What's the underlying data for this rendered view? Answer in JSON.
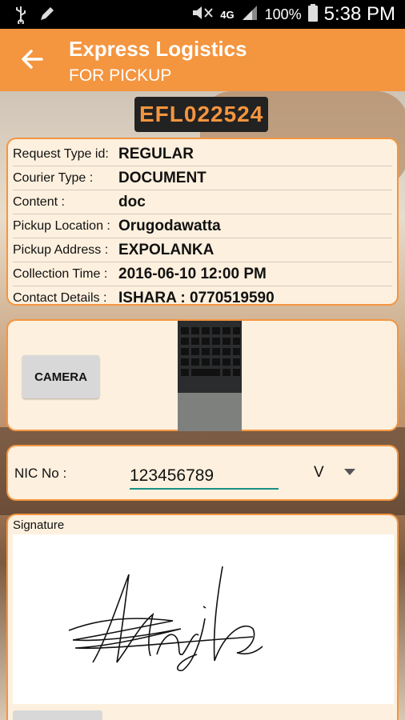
{
  "status_bar": {
    "time": "5:38 PM",
    "battery": "100%",
    "network": "4G",
    "icons": [
      "usb-icon",
      "pencil-icon",
      "mute-icon",
      "signal-icon",
      "battery-icon"
    ]
  },
  "app_bar": {
    "title": "Express Logistics",
    "subtitle": "FOR PICKUP",
    "back_icon": "arrow-back-icon",
    "color": "#f4953f"
  },
  "tracking_number": "EFL022524",
  "details": [
    {
      "label": "Request Type id:",
      "value": "REGULAR"
    },
    {
      "label": "Courier Type :",
      "value": "DOCUMENT"
    },
    {
      "label": "Content :",
      "value": "doc"
    },
    {
      "label": "Pickup Location :",
      "value": "Orugodawatta"
    },
    {
      "label": "Pickup Address :",
      "value": "EXPOLANKA"
    },
    {
      "label": "Collection Time :",
      "value": "2016-06-10 12:00 PM"
    },
    {
      "label": "Contact Details :",
      "value": "ISHARA : 0770519590"
    }
  ],
  "photo_section": {
    "camera_button": "CAMERA"
  },
  "nic": {
    "label": "NIC No :",
    "value": "123456789",
    "suffix": "V"
  },
  "signature": {
    "label": "Signature"
  }
}
